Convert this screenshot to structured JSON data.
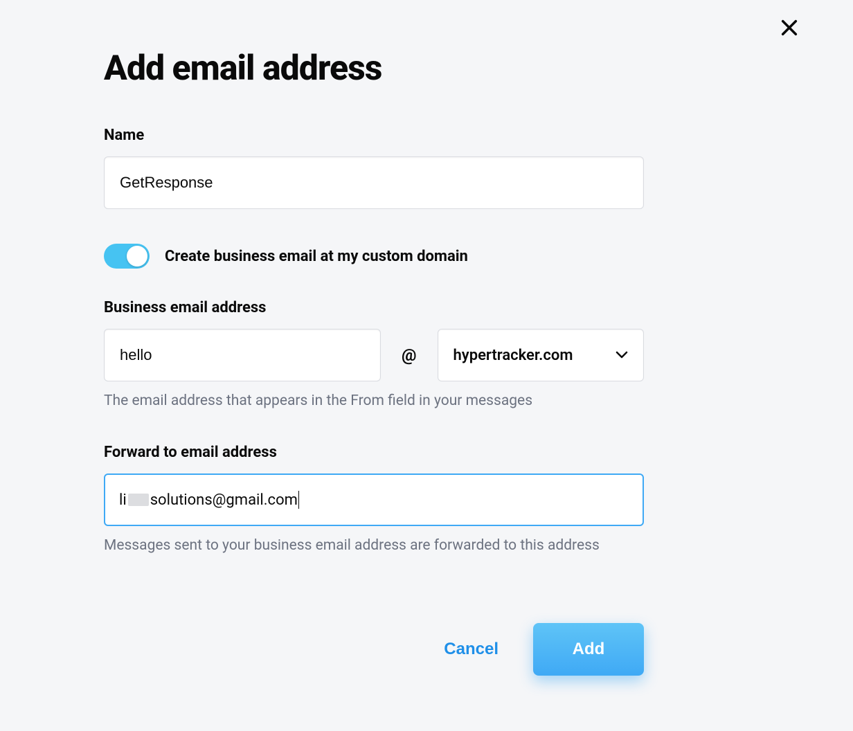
{
  "dialog": {
    "title": "Add email address",
    "close_icon": "close-icon"
  },
  "name_field": {
    "label": "Name",
    "value": "GetResponse"
  },
  "toggle": {
    "label": "Create business email at my custom domain",
    "enabled": true
  },
  "business_email": {
    "label": "Business email address",
    "local_value": "hello",
    "at": "@",
    "domain_value": "hypertracker.com",
    "hint": "The email address that appears in the From field in your messages"
  },
  "forward_email": {
    "label": "Forward to email address",
    "value_prefix": "li",
    "value_suffix": "solutions@gmail.com",
    "hint": "Messages sent to your business email address are forwarded to this address"
  },
  "buttons": {
    "cancel": "Cancel",
    "add": "Add"
  }
}
